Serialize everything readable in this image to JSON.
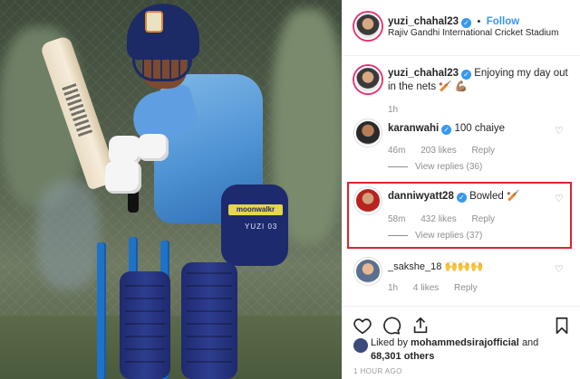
{
  "post": {
    "username": "yuzi_chahal23",
    "follow_label": "Follow",
    "location": "Rajiv Gandhi International Cricket Stadium",
    "caption": "Enjoying my day out in the nets 🏏 💪🏽",
    "caption_time": "1h"
  },
  "photo": {
    "thigh_brand": "moonwalkr",
    "thigh_name": "YUZI 03"
  },
  "comments": [
    {
      "username": "karanwahi",
      "verified": true,
      "text": "100 chaiye",
      "time": "46m",
      "likes": "203 likes",
      "reply": "Reply",
      "view_replies": "View replies (36)"
    },
    {
      "username": "danniwyatt28",
      "verified": true,
      "text": "Bowled 🏏",
      "time": "58m",
      "likes": "432 likes",
      "reply": "Reply",
      "view_replies": "View replies (37)"
    },
    {
      "username": "_sakshe_18",
      "verified": false,
      "text": "🙌🙌🙌",
      "time": "1h",
      "likes": "4 likes",
      "reply": "Reply"
    }
  ],
  "liked_by": {
    "prefix": "Liked by",
    "user": "mohammedsirajofficial",
    "and": "and",
    "others": "68,301 others"
  },
  "posted_ago": "1 HOUR AGO",
  "colors": {
    "accent": "#3897f0",
    "highlight": "#d9262b",
    "muted": "#8e8e8e"
  },
  "icons": [
    "heart-icon",
    "comment-icon",
    "share-icon",
    "bookmark-icon",
    "verified-badge-icon"
  ]
}
